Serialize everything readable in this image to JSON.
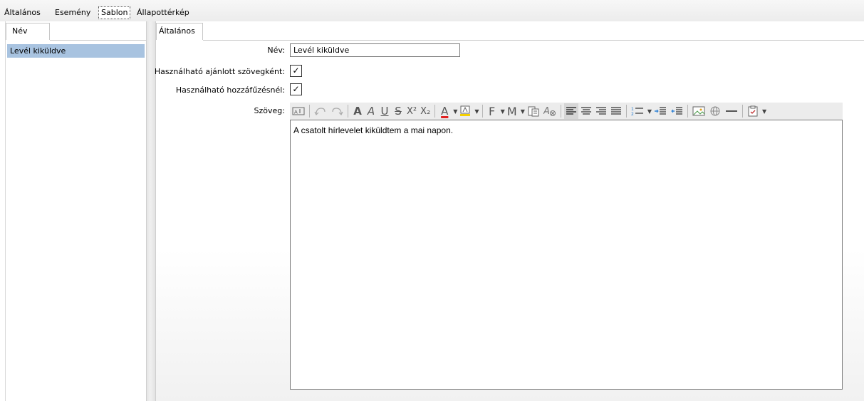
{
  "top_tabs": [
    "Általános",
    "Esemény",
    "Sablon",
    "Állapottérkép"
  ],
  "left": {
    "header": "Név",
    "items": [
      "Levél kiküldve"
    ]
  },
  "right": {
    "tab": "Általános",
    "name_label": "Név:",
    "name_value": "Levél kiküldve",
    "suggest_label": "Használható ajánlott szövegként:",
    "suggest_checked": true,
    "append_label": "Használható hozzáfűzésnél:",
    "append_checked": true,
    "text_label": "Szöveg:",
    "check_mark": "✓",
    "body_text": "A csatolt hírlevelet kiküldtem a mai napon."
  },
  "toolbar": {
    "bold": "A",
    "italic": "A",
    "underline": "U",
    "strike": "S",
    "superscript": "X²",
    "subscript": "X₂",
    "font_color": "A",
    "font_family": "F",
    "font_size": "M",
    "icons": [
      "text-field-icon",
      "undo-icon",
      "redo-icon",
      "bold-icon",
      "italic-icon",
      "underline-icon",
      "strikethrough-icon",
      "superscript-icon",
      "subscript-icon",
      "font-color-icon",
      "highlight-icon",
      "font-family-icon",
      "font-size-icon",
      "paste-icon",
      "clear-format-icon",
      "align-left-icon",
      "align-center-icon",
      "align-right-icon",
      "justify-icon",
      "numbered-list-icon",
      "indent-icon",
      "outdent-icon",
      "image-icon",
      "link-icon",
      "horizontal-line-icon",
      "clipboard-check-icon"
    ]
  },
  "colors": {
    "selection": "#a8c3e0",
    "font_color_bar": "#e02020",
    "highlight_bar": "#f5d000",
    "icon_gray": "#555555",
    "list_blue": "#2a7fd4"
  }
}
